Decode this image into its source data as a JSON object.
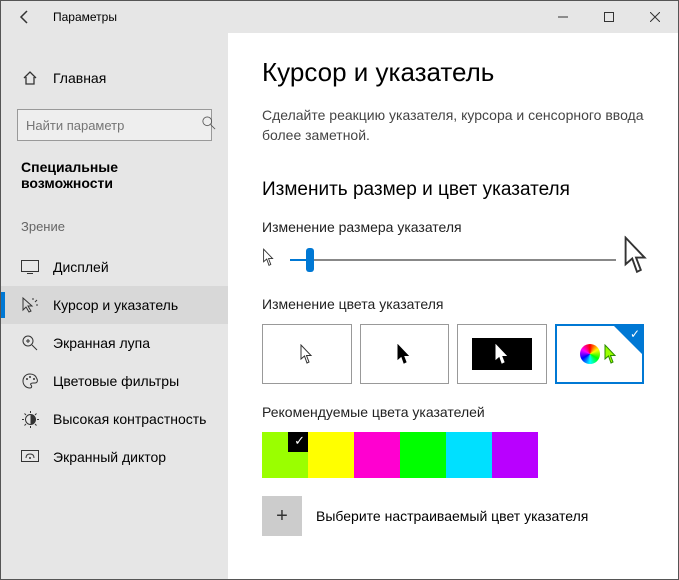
{
  "window": {
    "title": "Параметры"
  },
  "sidebar": {
    "home": "Главная",
    "search_placeholder": "Найти параметр",
    "section": "Специальные возможности",
    "group": "Зрение",
    "items": [
      {
        "label": "Дисплей"
      },
      {
        "label": "Курсор и указатель"
      },
      {
        "label": "Экранная лупа"
      },
      {
        "label": "Цветовые фильтры"
      },
      {
        "label": "Высокая контрастность"
      },
      {
        "label": "Экранный диктор"
      }
    ]
  },
  "page": {
    "title": "Курсор и указатель",
    "description": "Сделайте реакцию указателя, курсора и сенсорного ввода более заметной.",
    "section_heading": "Изменить размер и цвет указателя",
    "size_label": "Изменение размера указателя",
    "color_label": "Изменение цвета указателя",
    "recommended_label": "Рекомендуемые цвета указателей",
    "custom_label": "Выберите настраиваемый цвет указателя",
    "slider_value": 1,
    "color_option_selected": 3,
    "recommended_colors": [
      "#9aff00",
      "#ffff00",
      "#ff00d0",
      "#00ff00",
      "#00e0ff",
      "#b900ff"
    ],
    "recommended_selected": 0
  }
}
